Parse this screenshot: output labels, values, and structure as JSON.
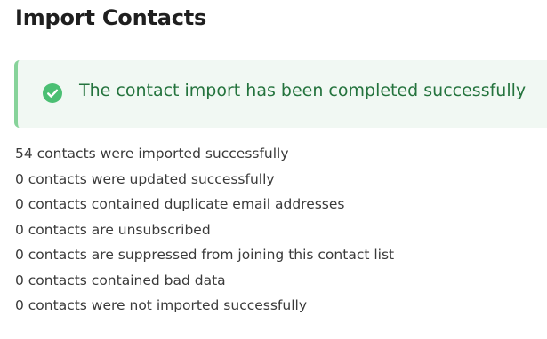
{
  "page": {
    "title": "Import Contacts"
  },
  "alert": {
    "icon": "check-circle-icon",
    "message": "The contact import has been completed successfully",
    "color": "#24733d",
    "background": "#f1f8f3",
    "accent": "#87d39a"
  },
  "results": [
    "54 contacts were imported successfully",
    "0 contacts were updated successfully",
    "0 contacts contained duplicate email addresses",
    "0 contacts are unsubscribed",
    "0 contacts are suppressed from joining this contact list",
    "0 contacts contained bad data",
    "0 contacts were not imported successfully"
  ]
}
